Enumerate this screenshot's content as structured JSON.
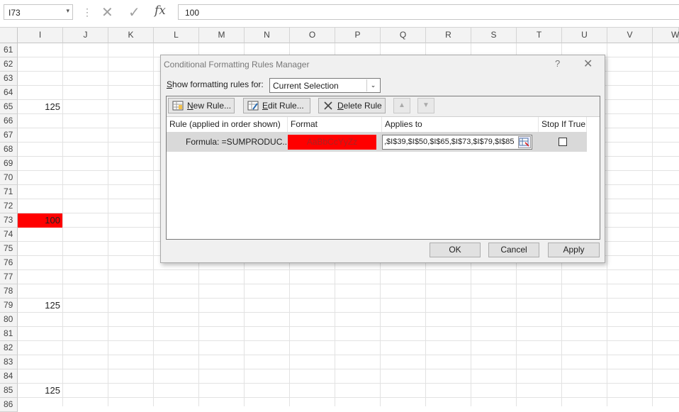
{
  "formula_bar": {
    "name_box": "I73",
    "name_box_arrow": "▾",
    "separator": "⋮",
    "cancel_glyph": "✕",
    "enter_glyph": "✓",
    "fx_label": "fx",
    "value": "100"
  },
  "columns": [
    "I",
    "J",
    "K",
    "L",
    "M",
    "N",
    "O",
    "P",
    "Q",
    "R",
    "S",
    "T",
    "U",
    "V",
    "W"
  ],
  "rows": [
    "61",
    "62",
    "63",
    "64",
    "65",
    "66",
    "67",
    "68",
    "69",
    "70",
    "71",
    "72",
    "73",
    "74",
    "75",
    "76",
    "77",
    "78",
    "79",
    "80",
    "81",
    "82",
    "83",
    "84",
    "85",
    "86"
  ],
  "cells": {
    "I65": "125",
    "I73": "100",
    "I79": "125",
    "I85": "125"
  },
  "dialog": {
    "title": "Conditional Formatting Rules Manager",
    "help_glyph": "?",
    "close_glyph": "✕",
    "show_label": "Show formatting rules for:",
    "show_value": "Current Selection",
    "select_arrow": "⌄",
    "toolbar": {
      "new_rule": "New Rule...",
      "edit_rule": "Edit Rule...",
      "delete_rule": "Delete Rule",
      "move_up": "▲",
      "move_down": "▼"
    },
    "columns": {
      "rule": "Rule (applied in order shown)",
      "format": "Format",
      "applies_to": "Applies to",
      "stop_if_true": "Stop If True"
    },
    "rules": [
      {
        "rule": "Formula: =SUMPRODUC...",
        "format_preview": "AaBbCcYyZz",
        "applies_to": ",$I$39,$I$50,$I$65,$I$73,$I$79,$I$85",
        "stop_if_true": false
      }
    ],
    "buttons": {
      "ok": "OK",
      "cancel": "Cancel",
      "apply": "Apply"
    }
  },
  "colors": {
    "highlight_red": "#ff0000",
    "format_text": "#aa2222",
    "grid_line": "#e2e2e2"
  }
}
